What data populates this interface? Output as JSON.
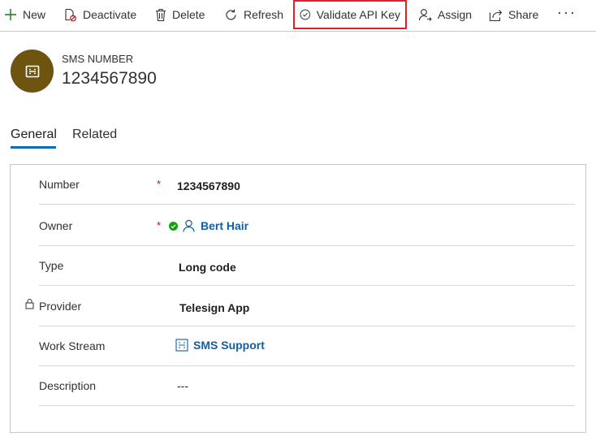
{
  "toolbar": {
    "new_label": "New",
    "deactivate_label": "Deactivate",
    "delete_label": "Delete",
    "refresh_label": "Refresh",
    "validate_label": "Validate API Key",
    "assign_label": "Assign",
    "share_label": "Share",
    "more_label": "···"
  },
  "header": {
    "entity_type": "SMS NUMBER",
    "record_name": "1234567890",
    "avatar_color": "#6e5410"
  },
  "tabs": [
    {
      "label": "General",
      "selected": true
    },
    {
      "label": "Related",
      "selected": false
    }
  ],
  "form": {
    "fields": [
      {
        "label": "Number",
        "required": "*",
        "value": "1234567890"
      },
      {
        "label": "Owner",
        "required": "*",
        "value": "Bert Hair"
      },
      {
        "label": "Type",
        "value": "Long code"
      },
      {
        "label": "Provider",
        "value": "Telesign App",
        "locked": true
      },
      {
        "label": "Work Stream",
        "value": "SMS Support"
      },
      {
        "label": "Description",
        "value": "---"
      }
    ]
  },
  "colors": {
    "accent": "#0f6cbd",
    "link": "#115ea3",
    "required": "#c50f1f",
    "highlight_border": "#d9232e",
    "status_ok": "#13a10e"
  }
}
